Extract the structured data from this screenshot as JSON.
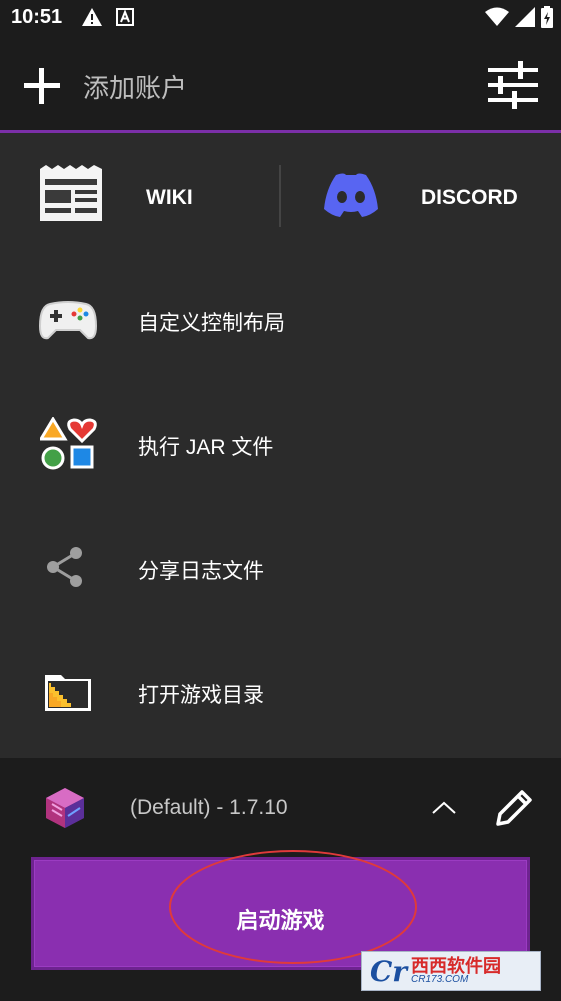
{
  "status_bar": {
    "time": "10:51",
    "icons": [
      "warning-icon",
      "a-notification-icon",
      "wifi-icon",
      "signal-icon",
      "battery-icon"
    ]
  },
  "top_bar": {
    "add_icon": "plus-icon",
    "add_account_label": "添加账户",
    "settings_icon": "sliders-icon"
  },
  "links": {
    "wiki_label": "WIKI",
    "discord_label": "DISCORD"
  },
  "menu": [
    {
      "label": "自定义控制布局",
      "icon": "gamepad-icon"
    },
    {
      "label": "执行 JAR 文件",
      "icon": "shapes-icon"
    },
    {
      "label": "分享日志文件",
      "icon": "share-icon"
    },
    {
      "label": "打开游戏目录",
      "icon": "folder-icon"
    }
  ],
  "launcher": {
    "version_label": "(Default) - 1.7.10",
    "launch_label": "启动游戏"
  },
  "watermark": {
    "logo": "Cr",
    "main": "西西软件园",
    "sub": "CR173.COM"
  },
  "colors": {
    "accent": "#7b2fa8",
    "launch_button": "#8a2fb0",
    "discord": "#5865f2",
    "highlight": "#e03a3a"
  }
}
